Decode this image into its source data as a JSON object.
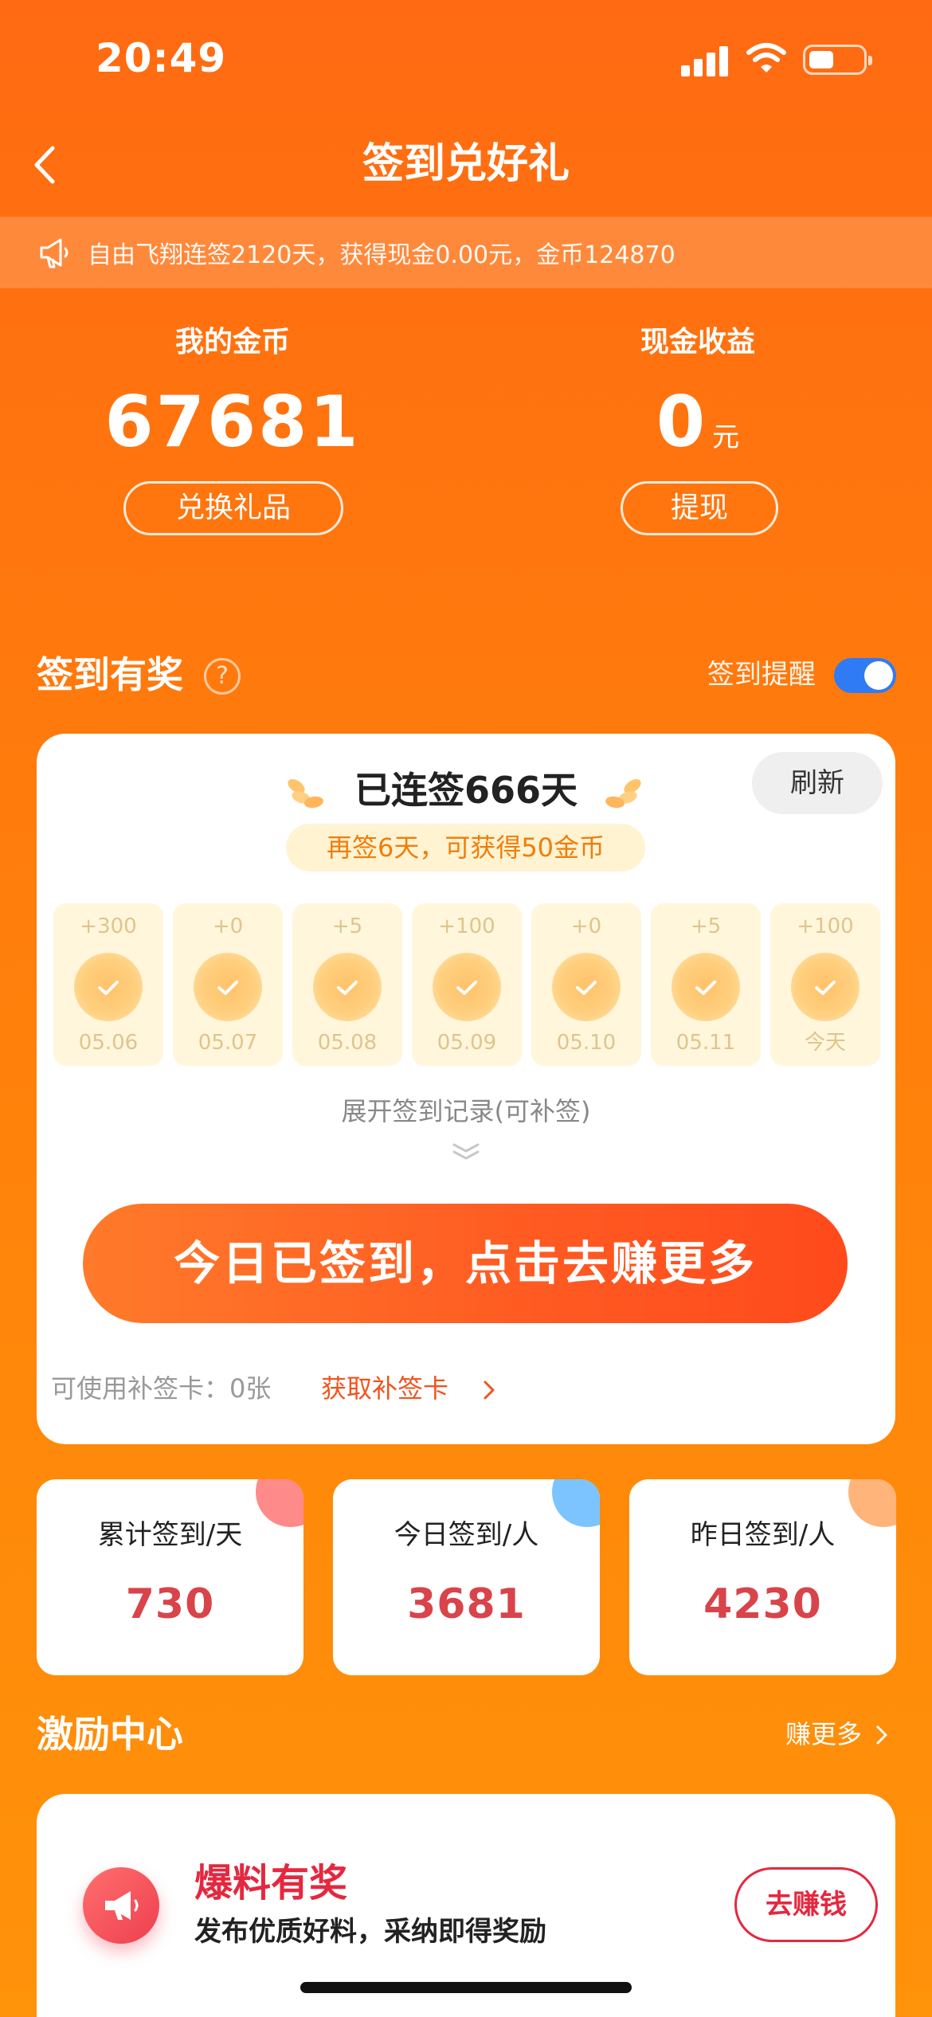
{
  "status_bar": {
    "time": "20:49"
  },
  "nav": {
    "title": "签到兑好礼"
  },
  "notice": {
    "text": "自由飞翔连签2120天，获得现金0.00元，金币124870"
  },
  "stats": {
    "coins_label": "我的金币",
    "coins_value": "67681",
    "exchange_button": "兑换礼品",
    "cash_label": "现金收益",
    "cash_value": "0",
    "cash_unit": "元",
    "withdraw_button": "提现"
  },
  "checkin_section": {
    "title": "签到有奖",
    "help_icon": "?",
    "remind_label": "签到提醒",
    "remind_enabled": true
  },
  "checkin_card": {
    "streak_text": "已连签666天",
    "refresh_button": "刷新",
    "hint": "再签6天，可获得50金币",
    "days": [
      {
        "points": "+300",
        "date": "05.06"
      },
      {
        "points": "+0",
        "date": "05.07"
      },
      {
        "points": "+5",
        "date": "05.08"
      },
      {
        "points": "+100",
        "date": "05.09"
      },
      {
        "points": "+0",
        "date": "05.10"
      },
      {
        "points": "+5",
        "date": "05.11"
      },
      {
        "points": "+100",
        "date": "今天"
      }
    ],
    "expand_text": "展开签到记录(可补签)",
    "main_button": "今日已签到，点击去赚更多",
    "makeup_text": "可使用补签卡：0张",
    "makeup_link": "获取补签卡"
  },
  "counts": [
    {
      "label": "累计签到/天",
      "value": "730",
      "corner_color": "#ff8a8a"
    },
    {
      "label": "今日签到/人",
      "value": "3681",
      "corner_color": "#7cc4ff"
    },
    {
      "label": "昨日签到/人",
      "value": "4230",
      "corner_color": "#ffb47a"
    }
  ],
  "incentive": {
    "title": "激励中心",
    "more": "赚更多",
    "card": {
      "name": "爆料有奖",
      "desc": "发布优质好料，采纳即得奖励",
      "button": "去赚钱"
    }
  },
  "colors": {
    "background": "#ff7c0c",
    "accent_red": "#d9434a",
    "toggle_blue": "#2f7bf5",
    "button_gradient_end": "#ff4a1c"
  }
}
